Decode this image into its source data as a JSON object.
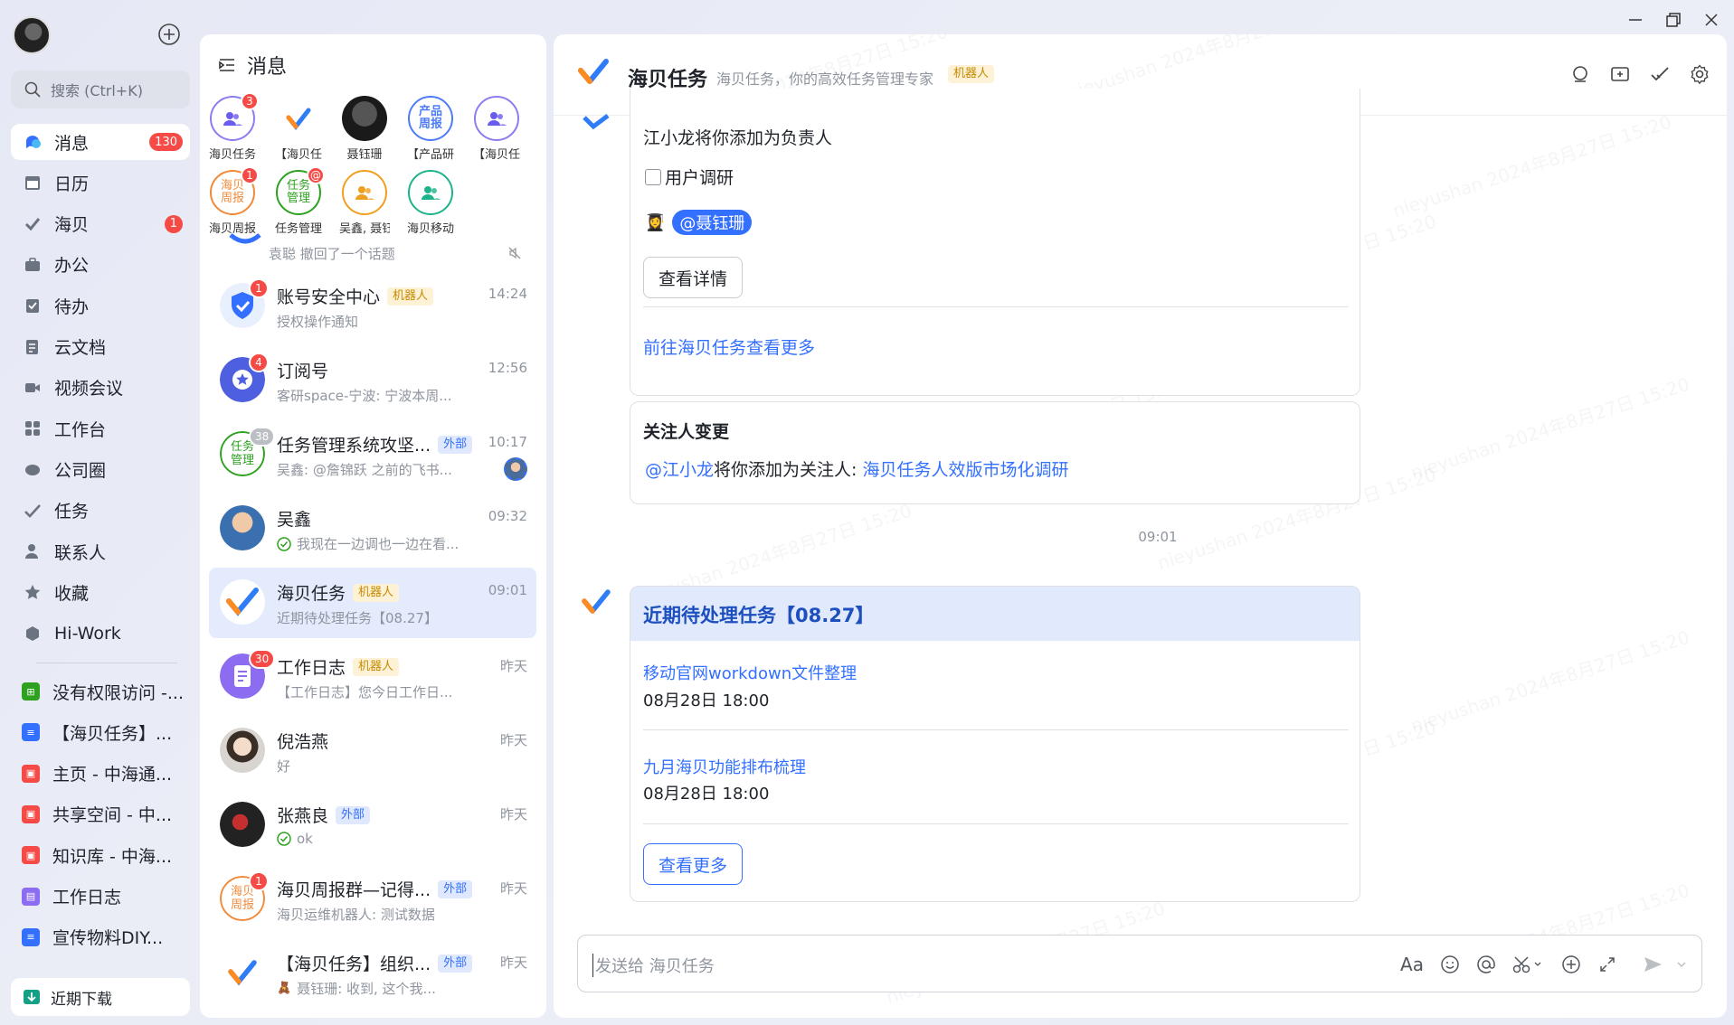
{
  "window": {
    "minimize_label": "—",
    "restore_label": "❐",
    "close_label": "✕"
  },
  "nav": {
    "search_placeholder": "搜索 (Ctrl+K)",
    "items": [
      {
        "label": "消息",
        "badge": "130",
        "icon": "chat-bubble-icon"
      },
      {
        "label": "日历",
        "badge": "",
        "icon": "calendar-icon"
      },
      {
        "label": "海贝",
        "badge": "1",
        "icon": "check-icon"
      },
      {
        "label": "办公",
        "badge": "",
        "icon": "briefcase-icon"
      },
      {
        "label": "待办",
        "badge": "",
        "icon": "todo-icon"
      },
      {
        "label": "云文档",
        "badge": "",
        "icon": "doc-icon"
      },
      {
        "label": "视频会议",
        "badge": "",
        "icon": "video-icon"
      },
      {
        "label": "工作台",
        "badge": "",
        "icon": "grid-icon"
      },
      {
        "label": "公司圈",
        "badge": "",
        "icon": "circle-icon"
      },
      {
        "label": "任务",
        "badge": "",
        "icon": "task-icon"
      },
      {
        "label": "联系人",
        "badge": "",
        "icon": "contacts-icon"
      },
      {
        "label": "收藏",
        "badge": "",
        "icon": "star-icon"
      },
      {
        "label": "Hi-Work",
        "badge": "",
        "icon": "hiwork-icon"
      }
    ],
    "shortcuts": [
      {
        "label": "没有权限访问 -...",
        "color": "#2ea121",
        "glyph": "⊞"
      },
      {
        "label": "【海贝任务】...",
        "color": "#3370ff",
        "glyph": "≡"
      },
      {
        "label": "主页 - 中海通...",
        "color": "#f54a45",
        "glyph": "▣"
      },
      {
        "label": "共享空间 - 中...",
        "color": "#f54a45",
        "glyph": "▣"
      },
      {
        "label": "知识库 - 中海...",
        "color": "#f54a45",
        "glyph": "▣"
      },
      {
        "label": "工作日志",
        "color": "#8c6cf0",
        "glyph": "▤"
      },
      {
        "label": "宣传物料DIY...",
        "color": "#3370ff",
        "glyph": "≡"
      }
    ],
    "downloads_label": "近期下载"
  },
  "messages": {
    "title": "消息",
    "pinned": [
      {
        "label": "海贝任务",
        "badge": "3",
        "kind": "group"
      },
      {
        "label": "【海贝任",
        "badge": "",
        "kind": "logo"
      },
      {
        "label": "聂钰珊",
        "badge": "",
        "kind": "photo"
      },
      {
        "label": "【产品研",
        "badge": "",
        "kind": "text",
        "text": "产品周报"
      },
      {
        "label": "【海贝任",
        "badge": "",
        "kind": "group"
      },
      {
        "label": "海贝周报",
        "badge": "1",
        "kind": "text-orange",
        "text": "海贝周报"
      },
      {
        "label": "任务管理",
        "badge": "@",
        "kind": "text-green",
        "text": "任务管理"
      },
      {
        "label": "吴鑫, 聂钰",
        "badge": "",
        "kind": "group-orange"
      },
      {
        "label": "海贝移动",
        "badge": "",
        "kind": "group-teal"
      }
    ],
    "partial_preview": "袁聪 撤回了一个话题",
    "chats": [
      {
        "name": "账号安全中心",
        "tag": "机器人",
        "tag_type": "bot",
        "preview": "授权操作通知",
        "time": "14:24",
        "badge": "1"
      },
      {
        "name": "订阅号",
        "tag": "",
        "tag_type": "",
        "preview": "客研space-宁波: 宁波本周...",
        "time": "12:56",
        "badge": "4"
      },
      {
        "name": "任务管理系统攻坚...",
        "tag": "外部",
        "tag_type": "ext",
        "preview": "吴鑫: @詹锦跃 之前的飞书...",
        "time": "10:17",
        "badge": "38"
      },
      {
        "name": "吴鑫",
        "tag": "",
        "tag_type": "",
        "preview": "我现在一边调也一边在看...",
        "time": "09:32",
        "badge": ""
      },
      {
        "name": "海贝任务",
        "tag": "机器人",
        "tag_type": "bot",
        "preview": "近期待处理任务【08.27】",
        "time": "09:01",
        "badge": ""
      },
      {
        "name": "工作日志",
        "tag": "机器人",
        "tag_type": "bot",
        "preview": "【工作日志】您今日工作日...",
        "time": "昨天",
        "badge": "30"
      },
      {
        "name": "倪浩燕",
        "tag": "",
        "tag_type": "",
        "preview": "好",
        "time": "昨天",
        "badge": ""
      },
      {
        "name": "张燕良",
        "tag": "外部",
        "tag_type": "ext",
        "preview": "ok",
        "time": "昨天",
        "badge": ""
      },
      {
        "name": "海贝周报群—记得...",
        "tag": "外部",
        "tag_type": "ext",
        "preview": "海贝运维机器人: 测试数据",
        "time": "昨天",
        "badge": "1"
      },
      {
        "name": "【海贝任务】组织...",
        "tag": "外部",
        "tag_type": "ext",
        "preview": "聂钰珊: 收到, 这个我...",
        "time": "昨天",
        "badge": ""
      }
    ]
  },
  "conversation": {
    "title": "海贝任务",
    "subtitle": "海贝任务，你的高效任务管理专家",
    "tag": "机器人",
    "card1": {
      "line": "江小龙将你添加为负责人",
      "task": "用户调研",
      "mention": "@聂钰珊",
      "detail_button": "查看详情",
      "more_link": "前往海贝任务查看更多"
    },
    "card2": {
      "title": "关注人变更",
      "mention": "@江小龙",
      "text": "将你添加为关注人:",
      "link": "海贝任务人效版市场化调研"
    },
    "time_divider": "09:01",
    "card3": {
      "title": "近期待处理任务【08.27】",
      "tasks": [
        {
          "name": "移动官网workdown文件整理",
          "due": "08月28日 18:00"
        },
        {
          "name": "九月海贝功能排布梳理",
          "due": "08月28日 18:00"
        }
      ],
      "more_button": "查看更多"
    },
    "input_placeholder": "发送给 海贝任务"
  },
  "watermark": "nieyushan 2024年8月27日 15:20",
  "colors": {
    "accent": "#3370ff",
    "badge": "#f54a45",
    "bot_tag_bg": "#fdf2d6",
    "ext_tag_bg": "#dfe8fd"
  }
}
